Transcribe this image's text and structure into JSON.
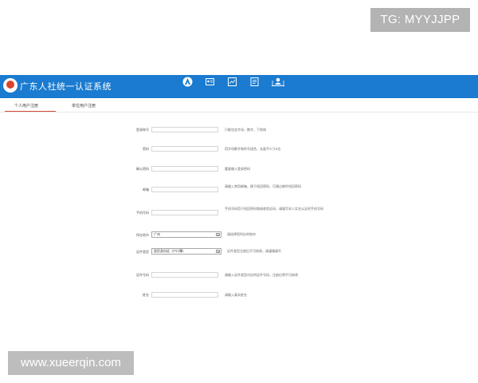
{
  "watermarks": {
    "top": "TG: MYYJJPP",
    "bottom": "www.xueerqin.com"
  },
  "header": {
    "title": "广东人社统一认证系统",
    "nav": [
      {
        "label": "",
        "icon": "person-icon"
      },
      {
        "label": "",
        "icon": "card-icon"
      },
      {
        "label": "",
        "icon": "chart-icon"
      },
      {
        "label": "",
        "icon": "doc-icon"
      },
      {
        "label": "",
        "icon": "user-desk-icon"
      }
    ]
  },
  "tabs": {
    "personal": "个人用户注册",
    "company": "单位用户注册"
  },
  "form": {
    "username": {
      "label": "登录帐号",
      "hint": "只能包含字母，数字，下划线"
    },
    "password": {
      "label": "密码",
      "hint": "用字母数字和符号组合，长度不少于8位"
    },
    "confirm_password": {
      "label": "确认密码",
      "hint": "重复输入登录密码"
    },
    "email": {
      "label": "邮箱",
      "hint": "请输入常用邮箱，便于找回密码，可通过邮件找回密码"
    },
    "mobile": {
      "label": "手机号码",
      "hint": "手机号码用于找回密码和接收验证码，请填写本人实名认证的手机号码"
    },
    "region": {
      "label": "所在地市",
      "value": "广州",
      "hint": "请选择您所在的地市"
    },
    "id_type": {
      "label": "证件类型",
      "value": "居民身份证（户口簿）",
      "hint": "证件类型注册后不可修改，请谨慎填写"
    },
    "id_number": {
      "label": "证件号码",
      "hint": "请输入证件类型对应的证件号码，注册后将不可修改"
    },
    "name": {
      "label": "姓名",
      "hint": "请输入真实姓名"
    }
  }
}
